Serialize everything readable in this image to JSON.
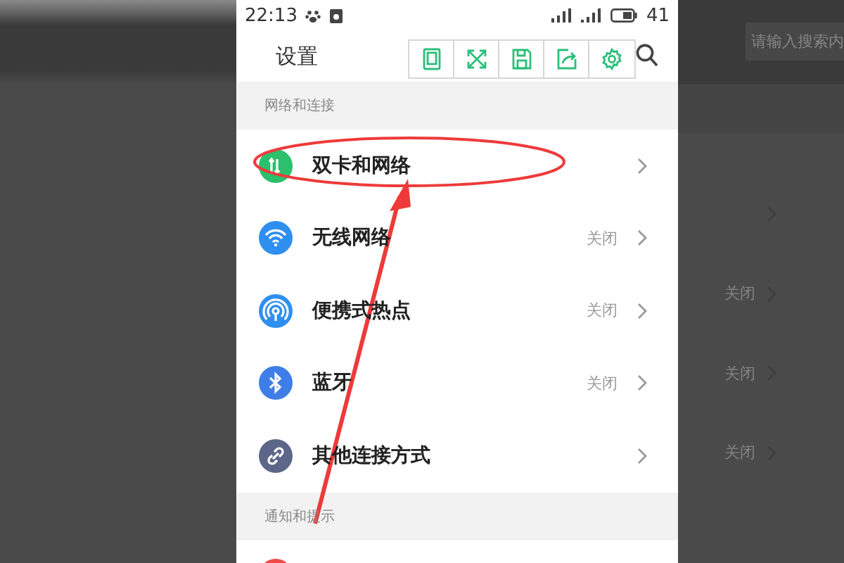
{
  "status_bar": {
    "time": "22:13",
    "battery": "41"
  },
  "header": {
    "title": "设置"
  },
  "toolbar": {
    "buttons": [
      {
        "kind": "phone"
      },
      {
        "kind": "expand"
      },
      {
        "kind": "save"
      },
      {
        "kind": "share"
      },
      {
        "kind": "gear"
      }
    ]
  },
  "sections": [
    {
      "title": "网络和连接",
      "items": [
        {
          "kind": "sim",
          "color": "#2cbf6c",
          "label": "双卡和网络"
        },
        {
          "kind": "wifi",
          "color": "#2f8ff0",
          "label": "无线网络",
          "value": "关闭"
        },
        {
          "kind": "hotspot",
          "color": "#2f8ff0",
          "label": "便携式热点",
          "value": "关闭"
        },
        {
          "kind": "bluetooth",
          "color": "#3f7ee8",
          "label": "蓝牙",
          "value": "关闭"
        },
        {
          "kind": "link",
          "color": "#5c6688",
          "label": "其他连接方式"
        }
      ]
    },
    {
      "title": "通知和提示",
      "items": [
        {
          "kind": "bell",
          "color": "#f04a4a"
        }
      ]
    }
  ],
  "background": {
    "search_placeholder": "请输入搜索内",
    "rows": [
      {
        "kind": "plain"
      },
      {
        "kind": "status",
        "value": "关闭"
      },
      {
        "kind": "status",
        "value": "关闭"
      },
      {
        "kind": "status",
        "value": "关闭"
      }
    ]
  }
}
